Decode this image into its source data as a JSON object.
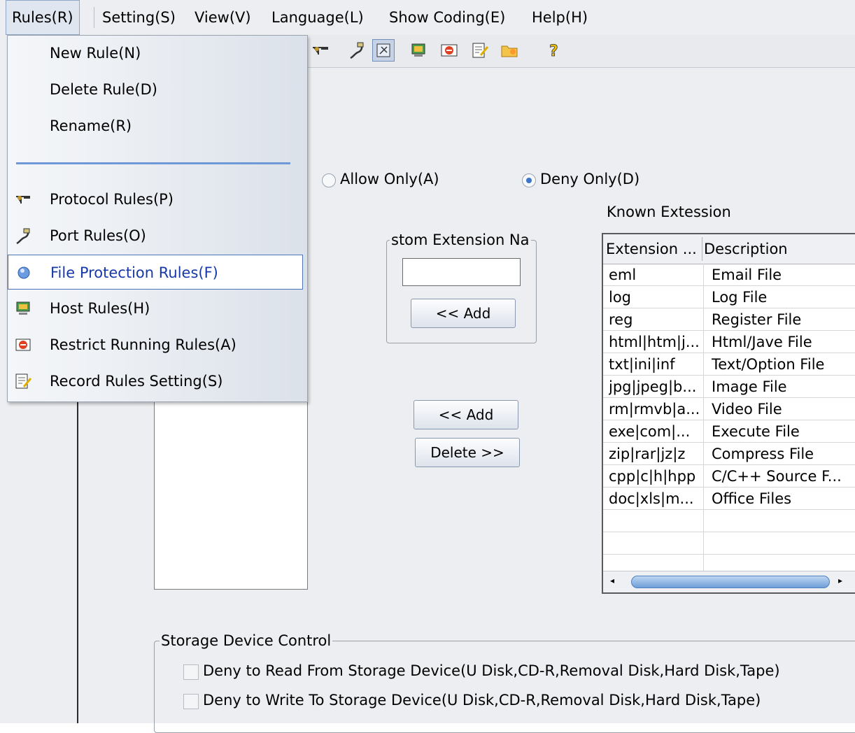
{
  "menubar": {
    "items": [
      {
        "label": "Rules(R)"
      },
      {
        "label": "Setting(S)"
      },
      {
        "label": "View(V)"
      },
      {
        "label": "Language(L)"
      },
      {
        "label": "Show Coding(E)"
      },
      {
        "label": "Help(H)"
      }
    ]
  },
  "dropdown": {
    "items": [
      {
        "label": "New Rule(N)"
      },
      {
        "label": "Delete Rule(D)"
      },
      {
        "label": "Rename(R)"
      },
      {
        "label": "Protocol Rules(P)",
        "icon": "protocol-icon"
      },
      {
        "label": "Port Rules(O)",
        "icon": "port-icon"
      },
      {
        "label": "File Protection Rules(F)",
        "icon": "file-protection-icon",
        "highlighted": true
      },
      {
        "label": "Host Rules(H)",
        "icon": "host-icon"
      },
      {
        "label": "Restrict Running Rules(A)",
        "icon": "restrict-running-icon"
      },
      {
        "label": "Record Rules Setting(S)",
        "icon": "record-rules-icon"
      }
    ]
  },
  "toolbar": {
    "buttons": [
      "protocol-icon",
      "port-icon",
      "file-protection-icon",
      "host-icon",
      "restrict-running-icon",
      "record-rules-icon",
      "folder-icon",
      "help-icon"
    ],
    "active": "file-protection-icon"
  },
  "mode": {
    "allow_label": "Allow Only(A)",
    "deny_label": "Deny Only(D)",
    "selected": "deny"
  },
  "custom": {
    "group_title": "stom Extension Na",
    "input_value": "",
    "add_label": "<< Add"
  },
  "actions": {
    "add_label": "<< Add",
    "delete_label": "Delete >>"
  },
  "known": {
    "title": "Known Extession",
    "columns": [
      "Extension ...",
      "Description"
    ],
    "rows": [
      {
        "ext": "eml",
        "desc": "Email File"
      },
      {
        "ext": "log",
        "desc": "Log File"
      },
      {
        "ext": "reg",
        "desc": "Register File"
      },
      {
        "ext": "html|htm|j...",
        "desc": "Html/Jave File"
      },
      {
        "ext": "txt|ini|inf",
        "desc": "Text/Option File"
      },
      {
        "ext": "jpg|jpeg|b...",
        "desc": "Image File"
      },
      {
        "ext": "rm|rmvb|a...",
        "desc": "Video File"
      },
      {
        "ext": "exe|com|...",
        "desc": "Execute File"
      },
      {
        "ext": "zip|rar|jz|z",
        "desc": "Compress File"
      },
      {
        "ext": "cpp|c|h|hpp",
        "desc": "C/C++ Source F..."
      },
      {
        "ext": "doc|xls|m...",
        "desc": "Office Files"
      }
    ]
  },
  "storage": {
    "title": "Storage Device Control",
    "deny_read_label": "Deny to Read From Storage Device(U Disk,CD-R,Removal Disk,Hard Disk,Tape)",
    "deny_write_label": "Deny to Write To Storage Device(U Disk,CD-R,Removal Disk,Hard Disk,Tape)",
    "deny_read_checked": false,
    "deny_write_checked": false
  }
}
